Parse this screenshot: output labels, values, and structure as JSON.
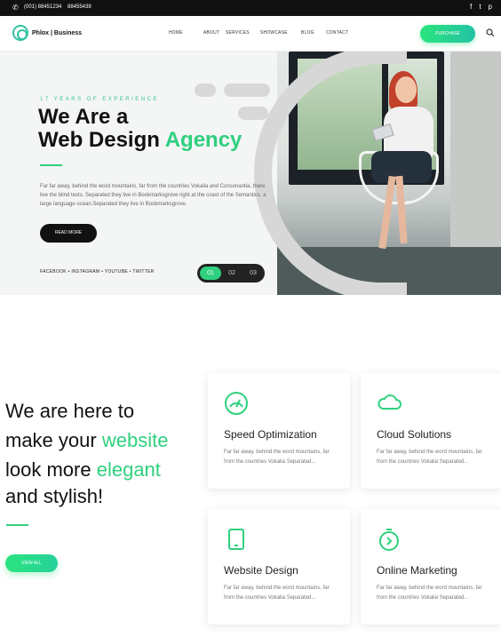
{
  "topbar": {
    "phone1": "(001) 88451234",
    "phone2": "88455438",
    "social": [
      "f",
      "t",
      "p"
    ]
  },
  "header": {
    "logo": "Phlox | Business",
    "menu": [
      "HOME",
      "ABOUT",
      "SERVICES",
      "SHOWCASE",
      "BLOG",
      "CONTACT"
    ],
    "purchase_label": "PURCHASE"
  },
  "hero": {
    "eyebrow": "17 YEARS OF EXPERIENCE",
    "title_line1": "We Are a",
    "title_line2_plain": "Web Design",
    "title_line2_accent": "Agency",
    "lead": "Far far away, behind the word mountains, far from the countries Vokalia and Consonantia, there live the blind texts. Separated they live in Bookmarksgrove right at the coast of the Semantics, a large language ocean.Separated they live in Bookmarksgrove.",
    "read_more_label": "READ MORE",
    "socials": "FACEBOOK  •  INSTAGRAM  •  YOUTUBE  •  TWITTER",
    "slides": [
      "01",
      "02",
      "03"
    ]
  },
  "intro": {
    "line1": "We are here to",
    "line2_plain": "make your",
    "line2_accent": "website",
    "line3_plain": "look more",
    "line3_accent": "elegant",
    "line4": "and stylish!",
    "view_all_label": "VIEW ALL"
  },
  "services": [
    {
      "title": "Speed Optimization",
      "desc": "Far far away, behind the word mountains, far from the countries Vokalia Separated...",
      "icon": "speedometer-icon"
    },
    {
      "title": "Cloud Solutions",
      "desc": "Far far away, behind the word mountains, far from the countries Vokalia Separated...",
      "icon": "cloud-icon"
    },
    {
      "title": "Website Design",
      "desc": "Far far away, behind the word mountains, far from the countries Vokalia Separated...",
      "icon": "mobile-icon"
    },
    {
      "title": "Online Marketing",
      "desc": "Far far away, behind the word mountains, far from the countries Vokalia Separated...",
      "icon": "stopwatch-icon"
    }
  ],
  "colors": {
    "accent": "#2fd07e",
    "dark": "#111111"
  }
}
